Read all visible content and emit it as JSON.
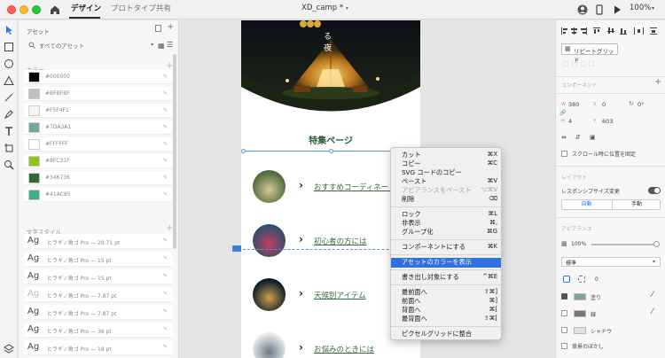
{
  "titlebar": {
    "tabs": [
      "デザイン",
      "プロトタイプ",
      "共有"
    ],
    "document_title": "XD_camp *",
    "zoom": "100%"
  },
  "assets": {
    "header": "アセット",
    "search_scope": "すべてのアセット",
    "colors_header": "カラー",
    "colors": [
      {
        "hex": "#000000",
        "label": "#000000"
      },
      {
        "hex": "#BFBFBF",
        "label": "#BFBFBF"
      },
      {
        "hex": "#F5F4F1",
        "label": "#F5F4F1"
      },
      {
        "hex": "#7DA3A1",
        "label": "#7DA3A1"
      },
      {
        "hex": "#FFFFFF",
        "label": "#FFFFFF"
      },
      {
        "hex": "#8FC31F",
        "label": "#8FC31F"
      },
      {
        "hex": "#346736",
        "label": "#346736"
      },
      {
        "hex": "#41AC85",
        "label": "#41AC85"
      }
    ],
    "text_styles_header": "文字スタイル",
    "text_styles": [
      {
        "ag": "Ag",
        "font": "ヒラギノ角ゴ Pro — 29.71 pt",
        "light": false
      },
      {
        "ag": "Ag",
        "font": "ヒラギノ角ゴ Pro — 15 pt",
        "light": false
      },
      {
        "ag": "Ag",
        "font": "ヒラギノ角ゴ Pro — 15 pt",
        "light": false
      },
      {
        "ag": "Ag",
        "font": "ヒラギノ角ゴ Pro — 7.87 pt",
        "light": true
      },
      {
        "ag": "Ag",
        "font": "ヒラギノ角ゴ Pro — 7.87 pt",
        "light": false
      },
      {
        "ag": "Ag",
        "font": "ヒラギノ角ゴ Pro — 36 pt",
        "light": false
      },
      {
        "ag": "Ag",
        "font": "ヒラギノ角ゴ Pro — 18 pt",
        "light": false
      }
    ]
  },
  "artboard": {
    "hero_text": "る\n夜",
    "section_title": "特集ページ",
    "items": [
      {
        "label": "おすすめコーディネート"
      },
      {
        "label": "初心者の方には"
      },
      {
        "label": "天候別アイテム"
      },
      {
        "label": "お悩みのときには"
      }
    ]
  },
  "context_menu": {
    "groups": [
      [
        {
          "label": "カット",
          "shortcut": "⌘X",
          "disabled": false
        },
        {
          "label": "コピー",
          "shortcut": "⌘C",
          "disabled": false
        },
        {
          "label": "SVG コードのコピー",
          "shortcut": "",
          "disabled": false
        },
        {
          "label": "ペースト",
          "shortcut": "⌘V",
          "disabled": false
        },
        {
          "label": "アピアランスをペースト",
          "shortcut": "⌥⌘V",
          "disabled": true
        },
        {
          "label": "削除",
          "shortcut": "⌫",
          "disabled": false
        }
      ],
      [
        {
          "label": "ロック",
          "shortcut": "⌘L",
          "disabled": false
        },
        {
          "label": "非表示",
          "shortcut": "⌘,",
          "disabled": false
        },
        {
          "label": "グループ化",
          "shortcut": "⌘G",
          "disabled": false
        }
      ],
      [
        {
          "label": "コンポーネントにする",
          "shortcut": "⌘K",
          "disabled": false
        }
      ],
      [
        {
          "label": "アセットのカラーを表示",
          "shortcut": "",
          "disabled": false,
          "highlighted": true
        }
      ],
      [
        {
          "label": "書き出し対象にする",
          "shortcut": "^⌘E",
          "disabled": false
        }
      ],
      [
        {
          "label": "最前面へ",
          "shortcut": "⇧⌘]",
          "disabled": false
        },
        {
          "label": "前面へ",
          "shortcut": "⌘]",
          "disabled": false
        },
        {
          "label": "背面へ",
          "shortcut": "⌘[",
          "disabled": false
        },
        {
          "label": "最背面へ",
          "shortcut": "⇧⌘[",
          "disabled": false
        }
      ],
      [
        {
          "label": "ピクセルグリッドに整合",
          "shortcut": "",
          "disabled": false
        }
      ]
    ]
  },
  "inspector": {
    "repeat_grid": "リピートグリッド",
    "component_header": "コンポーネント",
    "w_label": "W",
    "w": "380",
    "x_label": "X",
    "x": "0",
    "rot": "0°",
    "h_label": "H",
    "h": "4",
    "y_label": "Y",
    "y": "603",
    "scroll_fix": "スクロール時に位置を固定",
    "layout_header": "レイアウト",
    "responsive": "レスポンシブサイズ変更",
    "auto": "自動",
    "manual": "手動",
    "appearance_header": "アピアランス",
    "opacity": "100%",
    "blend": "標準",
    "corner": "0",
    "fill": "塗り",
    "border": "線",
    "shadow": "シャドウ",
    "bg_blur": "背景のぼかし"
  }
}
